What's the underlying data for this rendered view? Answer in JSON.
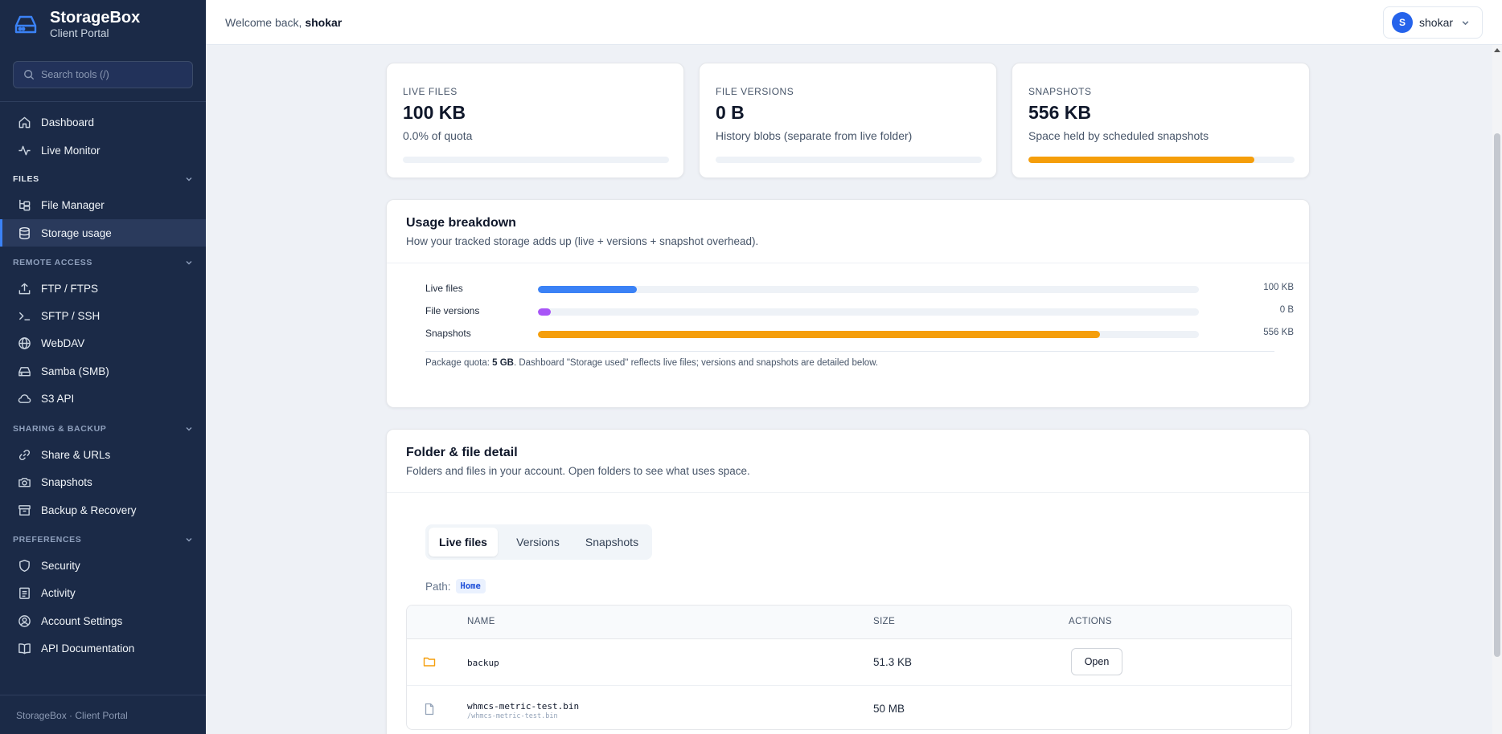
{
  "brand": {
    "title": "StorageBox",
    "subtitle": "Client Portal"
  },
  "search": {
    "placeholder": "Search tools (/)"
  },
  "nav": {
    "dashboard": "Dashboard",
    "live_monitor": "Live Monitor",
    "files_section": "FILES",
    "file_manager": "File Manager",
    "storage_usage": "Storage usage",
    "remote_section": "REMOTE ACCESS",
    "ftp": "FTP / FTPS",
    "sftp": "SFTP / SSH",
    "webdav": "WebDAV",
    "samba": "Samba (SMB)",
    "s3": "S3 API",
    "sharing_section": "SHARING & BACKUP",
    "share": "Share & URLs",
    "snapshots": "Snapshots",
    "backup": "Backup & Recovery",
    "prefs_section": "PREFERENCES",
    "security": "Security",
    "activity": "Activity",
    "account": "Account Settings",
    "api_docs": "API Documentation"
  },
  "footer": "StorageBox · Client Portal",
  "header": {
    "welcome": "Welcome back,",
    "username": "shokar",
    "avatar_initial": "S"
  },
  "stats": [
    {
      "label": "LIVE FILES",
      "value": "100 KB",
      "desc": "0.0% of quota",
      "fill_percent": 0
    },
    {
      "label": "FILE VERSIONS",
      "value": "0 B",
      "desc": "History blobs (separate from live folder)",
      "fill_percent": 0
    },
    {
      "label": "SNAPSHOTS",
      "value": "556 KB",
      "desc": "Space held by scheduled snapshots",
      "fill_percent": 85
    }
  ],
  "breakdown": {
    "title": "Usage breakdown",
    "subtitle": "How your tracked storage adds up (live + versions + snapshot overhead).",
    "rows": [
      {
        "label": "Live files",
        "value": "100 KB",
        "fill_percent": 15,
        "color": "#3b82f6"
      },
      {
        "label": "File versions",
        "value": "0 B",
        "fill_percent": 2,
        "color": "#a855f7"
      },
      {
        "label": "Snapshots",
        "value": "556 KB",
        "fill_percent": 85,
        "color": "#f59e0b"
      }
    ],
    "quota_prefix": "Package quota:",
    "quota_value": "5 GB",
    "quota_suffix": ". Dashboard \"Storage used\" reflects live files; versions and snapshots are detailed below."
  },
  "detail": {
    "title": "Folder & file detail",
    "subtitle": "Folders and files in your account. Open folders to see what uses space.",
    "tabs": [
      "Live files",
      "Versions",
      "Snapshots"
    ],
    "path_label": "Path:",
    "path_value": "Home",
    "columns": [
      "NAME",
      "SIZE",
      "ACTIONS"
    ],
    "rows": [
      {
        "name": "backup",
        "size": "51.3 KB",
        "action": "Open",
        "icon": "folder-icon"
      },
      {
        "name": "whmcs-metric-test.bin",
        "subpath": "/whmcs-metric-test.bin",
        "size": "50 MB",
        "icon": "file-icon"
      }
    ]
  },
  "colors": {
    "sidebar": "#1b2a47",
    "accent": "#3b82f6",
    "snapshot": "#f59e0b",
    "versions": "#a855f7"
  }
}
